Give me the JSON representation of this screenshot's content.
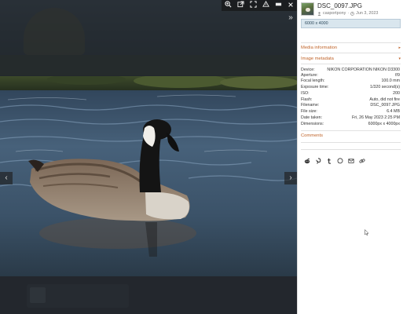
{
  "toolbar": {
    "zoom_icon": "zoom-in-icon",
    "open_icon": "external-link-icon",
    "fullscreen_icon": "fullscreen-icon",
    "tag_icon": "tag-icon",
    "menu_icon": "menu-icon",
    "close_icon": "close-icon"
  },
  "media": {
    "title": "DSC_0097.JPG",
    "author": "casportpony",
    "date": "Jun 3, 2023",
    "description": "6000 x 4000"
  },
  "sections": {
    "media_information": "Media information",
    "image_metadata": "Image metadata",
    "comments": "Comments"
  },
  "metadata": [
    {
      "key": "Device:",
      "value": "NIKON CORPORATION NIKON D3300"
    },
    {
      "key": "Aperture:",
      "value": "f/9"
    },
    {
      "key": "Focal length:",
      "value": "100.0 mm"
    },
    {
      "key": "Exposure time:",
      "value": "1/320 second(s)"
    },
    {
      "key": "ISO:",
      "value": "200"
    },
    {
      "key": "Flash:",
      "value": "Auto, did not fire"
    },
    {
      "key": "Filename:",
      "value": "DSC_0097.JPG"
    },
    {
      "key": "File size:",
      "value": "6.4 MB"
    },
    {
      "key": "Date taken:",
      "value": "Fri, 26 May 2023 2:25 PM"
    },
    {
      "key": "Dimensions:",
      "value": "6000px x 4000px"
    }
  ],
  "share": [
    "reddit-icon",
    "pinterest-icon",
    "tumblr-icon",
    "whatsapp-icon",
    "email-icon",
    "link-icon"
  ],
  "colors": {
    "accent": "#c0642a",
    "description_bg": "#d9e6ee"
  }
}
